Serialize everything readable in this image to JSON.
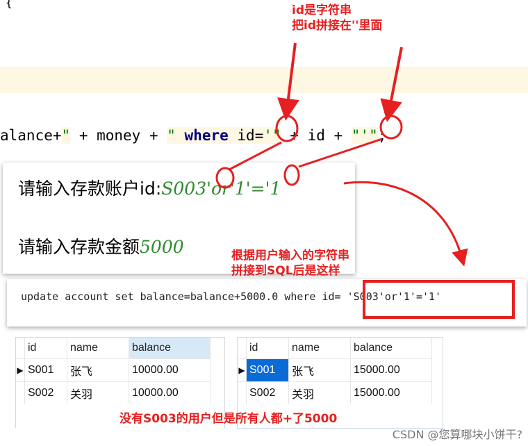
{
  "editor": {
    "brace": "{",
    "code": {
      "p1": "alance+",
      "p2": "\"",
      "p3": " + money + ",
      "p4": "\" ",
      "p5": "where",
      "p6": " id=",
      "p7": "'\"",
      "p8": " + id + ",
      "p9": "\"'\"",
      "p10": ";"
    }
  },
  "console": {
    "prompt_account_label": "请输入存款账户id:",
    "prompt_account_value": "S003'or'1'='1",
    "prompt_amount_label": "请输入存款金额",
    "prompt_amount_value": "5000",
    "sql_output": "update account set balance=balance+5000.0 where id= 'S003'or'1'='1'"
  },
  "annotations": {
    "top_line1": "id是字符串",
    "top_line2": "把id拼接在''里面",
    "mid_line1": "根据用户输入的字符串",
    "mid_line2": "拼接到SQL后是这样",
    "bottom": "没有S003的用户但是所有人都+了5000"
  },
  "table_before": {
    "columns": [
      "id",
      "name",
      "balance"
    ],
    "rows": [
      [
        "S001",
        "张飞",
        "10000.00"
      ],
      [
        "S002",
        "关羽",
        "10000.00"
      ]
    ]
  },
  "table_after": {
    "columns": [
      "id",
      "name",
      "balance"
    ],
    "rows": [
      [
        "S001",
        "张飞",
        "15000.00"
      ],
      [
        "S002",
        "关羽",
        "15000.00"
      ]
    ]
  },
  "watermark": "CSDN @您算哪块小饼干?",
  "colors": {
    "annotation_red": "#e62020",
    "string_green": "#008000",
    "keyword_navy": "#000080",
    "selection_blue": "#0a6ad6"
  }
}
